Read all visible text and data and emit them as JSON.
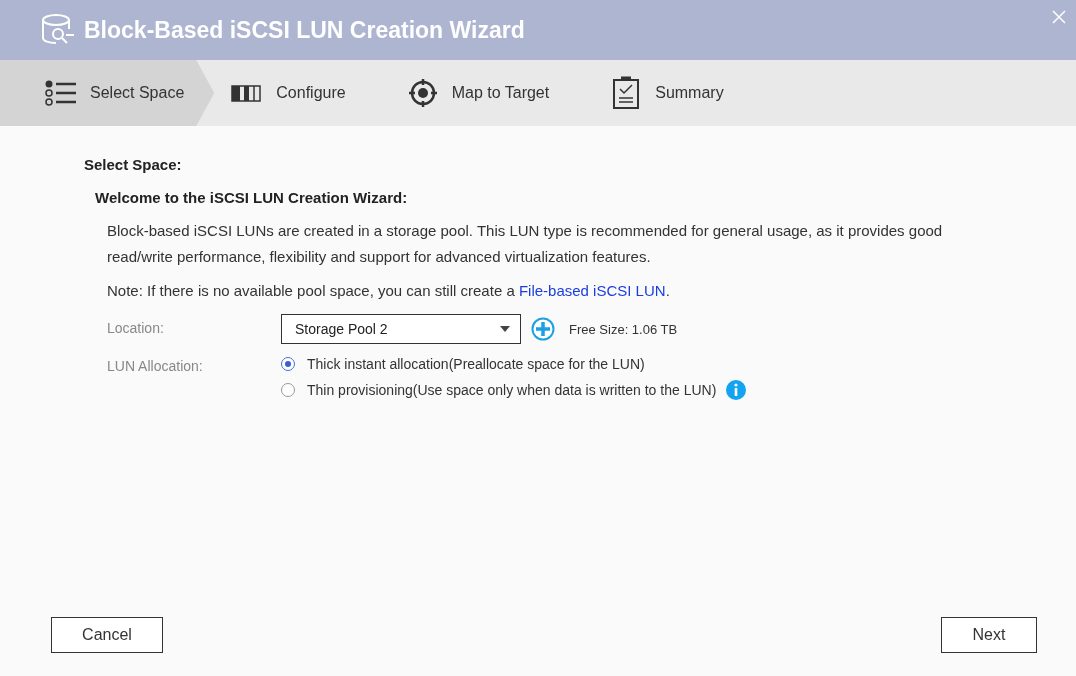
{
  "window": {
    "title": "Block-Based iSCSI LUN Creation Wizard"
  },
  "steps": [
    {
      "label": "Select Space",
      "kind": "list",
      "selected": true
    },
    {
      "label": "Configure",
      "kind": "bars",
      "selected": false
    },
    {
      "label": "Map to Target",
      "kind": "target",
      "selected": false
    },
    {
      "label": "Summary",
      "kind": "clipboard",
      "selected": false
    }
  ],
  "section_title": "Select Space:",
  "welcome": "Welcome to the iSCSI LUN Creation Wizard:",
  "description": "Block-based iSCSI LUNs are created in a storage pool. This LUN type is recommended for general usage, as it provides good read/write performance, flexibility and support for advanced virtualization features.",
  "note": {
    "text": "Note: If there is no available pool space, you can still create a ",
    "link": "File-based iSCSI LUN",
    "end": "."
  },
  "location": {
    "label": "Location:",
    "value": "Storage Pool 2",
    "free_size": "Free Size: 1.06 TB"
  },
  "allocation": {
    "label": "LUN Allocation:",
    "options": [
      {
        "label": "Thick instant allocation(Preallocate space for the LUN)",
        "selected": true,
        "info": false
      },
      {
        "label": "Thin provisioning(Use space only when data is written to the LUN)",
        "selected": false,
        "info": true
      }
    ]
  },
  "buttons": {
    "cancel": "Cancel",
    "next": "Next"
  }
}
